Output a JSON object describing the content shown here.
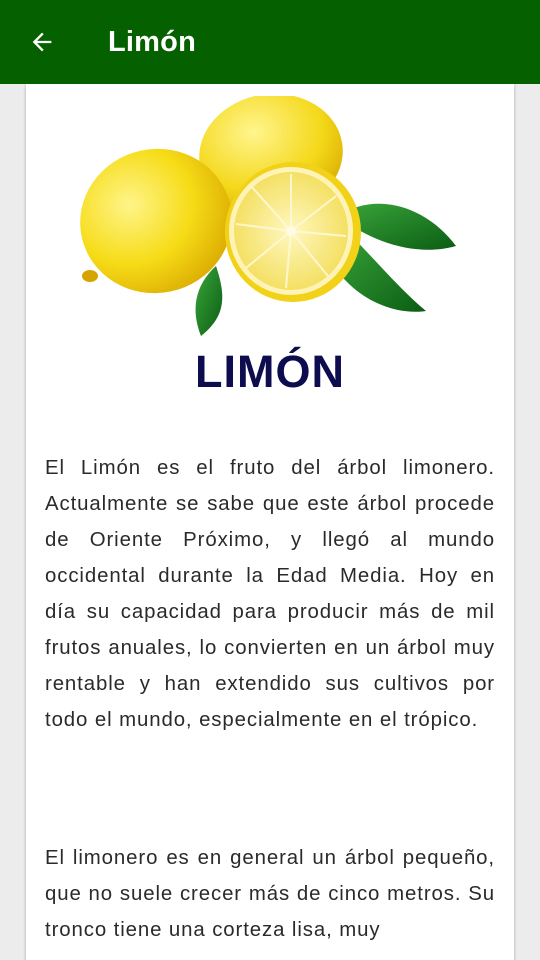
{
  "app_bar": {
    "title": "Limón",
    "back_icon": "arrow-left-icon",
    "background": "#056000"
  },
  "article": {
    "image_icon": "lemon-image",
    "heading": "LIMÓN",
    "heading_color": "#0c0c4e",
    "paragraphs": [
      "El Limón es el fruto del árbol limonero. Actualmente se sabe que este árbol procede de Oriente Próximo, y llegó al mundo occidental durante la Edad Media. Hoy en día su capacidad para producir más de mil frutos anuales, lo convierten en un árbol muy rentable y han extendido sus cultivos por todo el mundo, especialmente en el trópico.",
      "El limonero es en general un árbol pequeño, que no suele crecer más de cinco metros. Su tronco tiene una corteza lisa, muy"
    ]
  }
}
